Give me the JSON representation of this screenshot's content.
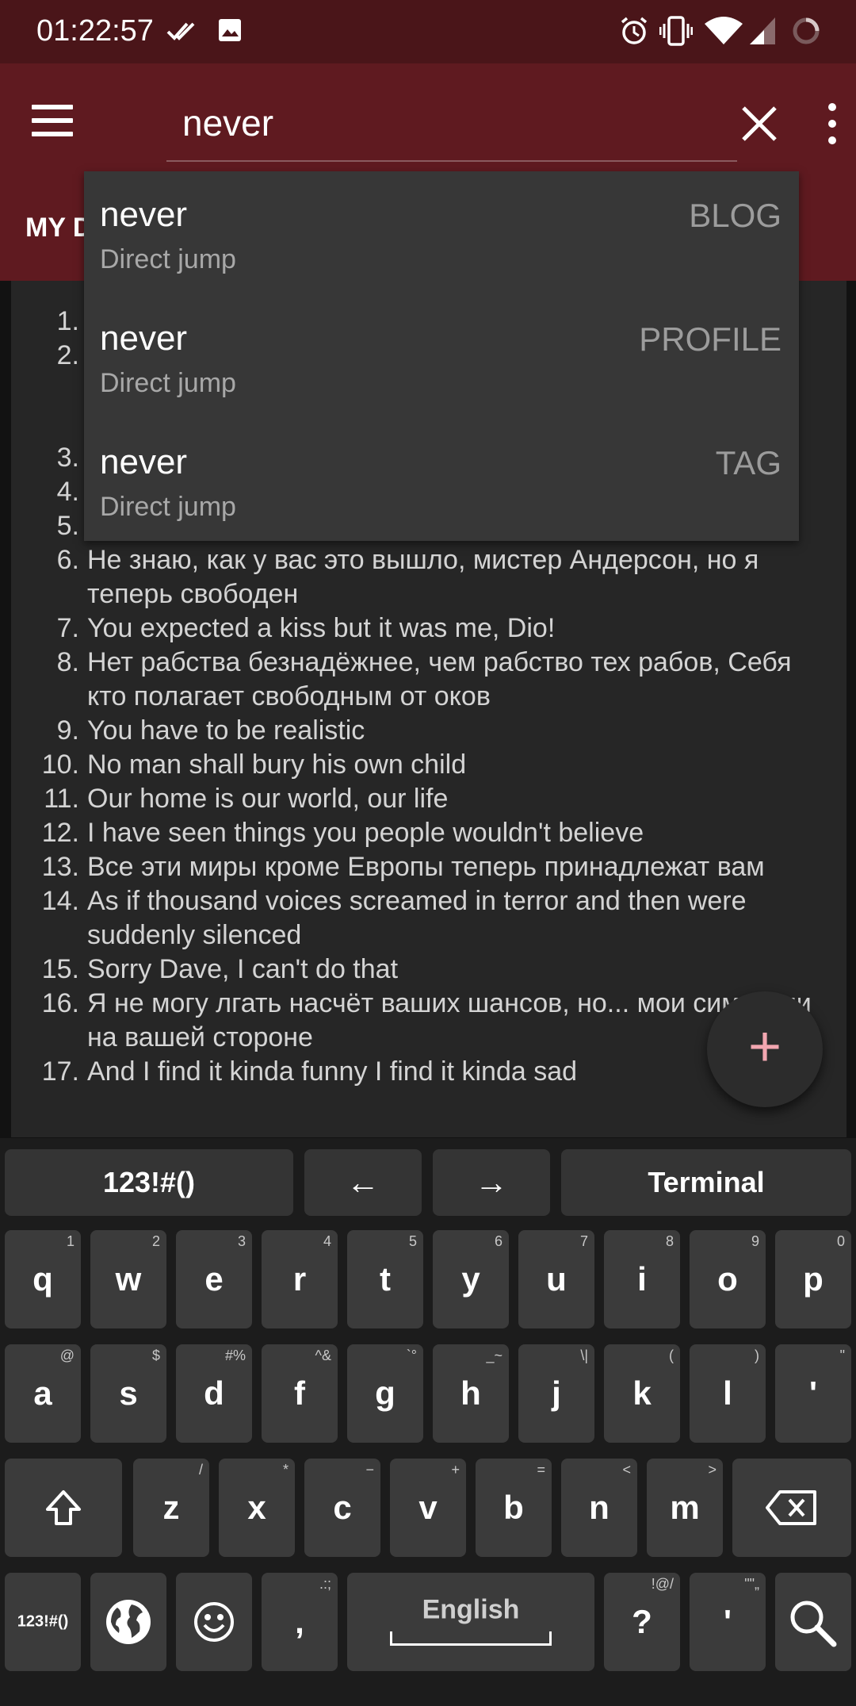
{
  "status_bar": {
    "time": "01:22:57",
    "icons": [
      "done-all-icon",
      "image-icon",
      "alarm-icon",
      "vibrate-icon",
      "wifi-icon",
      "signal-icon",
      "loading-icon"
    ]
  },
  "app_bar": {
    "search_value": "never",
    "tab_label": "MY D"
  },
  "suggestions": [
    {
      "title": "never",
      "subtitle": "Direct jump",
      "type": "BLOG"
    },
    {
      "title": "never",
      "subtitle": "Direct jump",
      "type": "PROFILE"
    },
    {
      "title": "never",
      "subtitle": "Direct jump",
      "type": "TAG"
    }
  ],
  "list_items": [
    {
      "num": "1.",
      "text": ""
    },
    {
      "num": "2.",
      "text": ""
    },
    {
      "num": "3.",
      "text": ""
    },
    {
      "num": "4.",
      "text": ""
    },
    {
      "num": "5.",
      "text": ""
    },
    {
      "num": "6.",
      "text": "Не знаю, как у вас это вышло, мистер Андерсон, но я теперь свободен"
    },
    {
      "num": "7.",
      "text": "You expected a kiss but it was me, Dio!"
    },
    {
      "num": "8.",
      "text": "Нет рабства безнадёжнее, чем рабство тех рабов, Себя кто полагает свободным от оков"
    },
    {
      "num": "9.",
      "text": "You have to be realistic"
    },
    {
      "num": "10.",
      "text": "No man shall bury his own child"
    },
    {
      "num": "11.",
      "text": "Our home is our world, our life"
    },
    {
      "num": "12.",
      "text": "I have seen things you people wouldn't believe"
    },
    {
      "num": "13.",
      "text": "Все эти миры кроме Европы теперь принадлежат вам"
    },
    {
      "num": "14.",
      "text": "As if thousand voices screamed in terror and then were suddenly silenced"
    },
    {
      "num": "15.",
      "text": "Sorry Dave, I can't do that"
    },
    {
      "num": "16.",
      "text": "Я не могу лгать насчёт ваших шансов, но... мои симпатии на вашей стороне"
    },
    {
      "num": "17.",
      "text": "And I find it kinda funny I find it kinda sad"
    }
  ],
  "fab": {
    "label": "+"
  },
  "keyboard": {
    "top_row": {
      "symbols": "123!#()",
      "left": "←",
      "right": "→",
      "terminal": "Terminal"
    },
    "row1": [
      {
        "key": "q",
        "hint": "1"
      },
      {
        "key": "w",
        "hint": "2"
      },
      {
        "key": "e",
        "hint": "3"
      },
      {
        "key": "r",
        "hint": "4"
      },
      {
        "key": "t",
        "hint": "5"
      },
      {
        "key": "y",
        "hint": "6"
      },
      {
        "key": "u",
        "hint": "7"
      },
      {
        "key": "i",
        "hint": "8"
      },
      {
        "key": "o",
        "hint": "9"
      },
      {
        "key": "p",
        "hint": "0"
      }
    ],
    "row2": [
      {
        "key": "a",
        "hint": "@"
      },
      {
        "key": "s",
        "hint": "$"
      },
      {
        "key": "d",
        "hint": "#%"
      },
      {
        "key": "f",
        "hint": "^&"
      },
      {
        "key": "g",
        "hint": "`°"
      },
      {
        "key": "h",
        "hint": "_~"
      },
      {
        "key": "j",
        "hint": "\\|"
      },
      {
        "key": "k",
        "hint": "("
      },
      {
        "key": "l",
        "hint": ")"
      },
      {
        "key": "'",
        "hint": "\""
      }
    ],
    "row3": [
      {
        "key": "z",
        "hint": "/"
      },
      {
        "key": "x",
        "hint": "*"
      },
      {
        "key": "c",
        "hint": "−"
      },
      {
        "key": "v",
        "hint": "+"
      },
      {
        "key": "b",
        "hint": "="
      },
      {
        "key": "n",
        "hint": "<"
      },
      {
        "key": "m",
        "hint": ">"
      }
    ],
    "bottom": {
      "symbols": "123!#()",
      "comma": ",",
      "comma_hint": ".:;",
      "space": "English",
      "question": "?",
      "question_hint": "!@/",
      "apostrophe": "'",
      "apostrophe_hint": "\"\"„"
    }
  }
}
